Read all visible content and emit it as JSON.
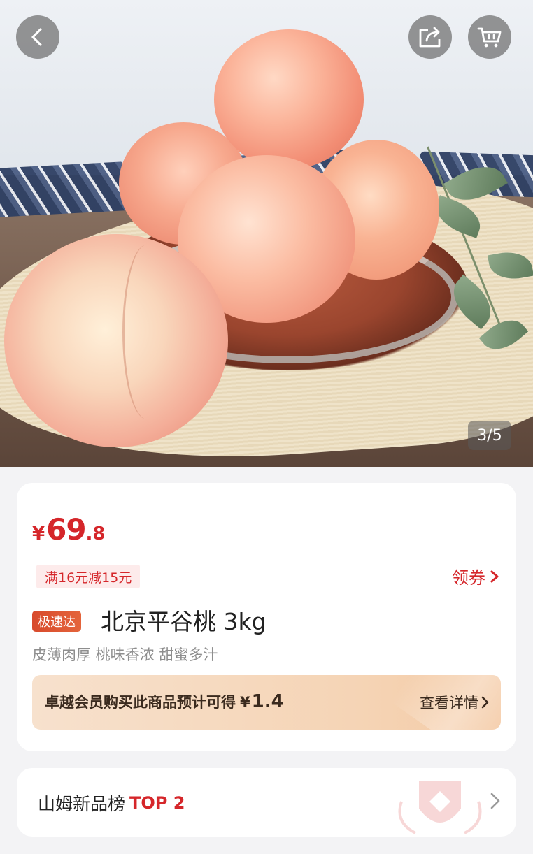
{
  "image_viewer": {
    "counter": "3/5",
    "icons": {
      "back": "chevron-left-icon",
      "share": "share-icon",
      "cart": "cart-icon"
    }
  },
  "product": {
    "price": {
      "currency": "¥",
      "integer": "69",
      "decimal": ".8"
    },
    "promo_tag": "满16元减15元",
    "coupon_label": "领券",
    "express_badge": "极速达",
    "title": "北京平谷桃 3kg",
    "subtitle": "皮薄肉厚 桃味香浓 甜蜜多汁"
  },
  "member": {
    "text": "卓越会员购买此商品预计可得",
    "currency": "¥",
    "amount": "1.4",
    "link_label": "查看详情"
  },
  "ranking": {
    "label": "山姆新品榜",
    "rank": "TOP 2"
  },
  "colors": {
    "accent_red": "#d5262a",
    "member_gold": "#f5d4b5",
    "background": "#f3f3f5"
  }
}
